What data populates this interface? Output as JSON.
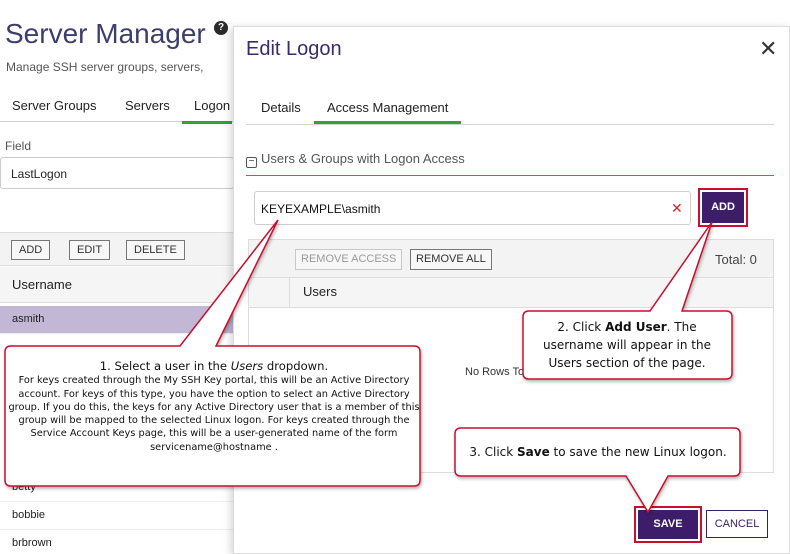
{
  "background": {
    "title": "Server Manager",
    "help_icon": "question-circle-icon",
    "subtitle": "Manage SSH server groups, servers,",
    "tabs": [
      "Server Groups",
      "Servers",
      "Logon"
    ],
    "field_label": "Field",
    "field_value": "LastLogon",
    "toolbar": [
      "ADD",
      "EDIT",
      "DELETE"
    ],
    "grid_header": "Username",
    "rows": [
      "asmith",
      "betty",
      "bobbie",
      "brbrown"
    ]
  },
  "dialog": {
    "title": "Edit Logon",
    "close_icon": "close-x-icon",
    "tabs": [
      "Details",
      "Access Management"
    ],
    "section_title": "Users & Groups with Logon Access",
    "user_value": "KEYEXAMPLE\\asmith",
    "add_label": "ADD",
    "remove_access_label": "REMOVE ACCESS",
    "remove_all_label": "REMOVE ALL",
    "total_label": "Total: 0",
    "users_header": "Users",
    "no_rows": "No Rows To",
    "save_label": "SAVE",
    "cancel_label": "CANCEL"
  },
  "callouts": {
    "step1_lead_a": "1. Select a  user in the ",
    "step1_lead_em": "Users",
    "step1_lead_b": " dropdown.",
    "step1_body": "For keys created through the My SSH Key portal, this will be an Active Directory account. For keys of this type, you have the option to select an Active Directory group. If you do this, the keys for any Active Directory user that is a member of this group will be mapped to the selected Linux logon. For keys created through the Service Account Keys page, this will be a user-generated name of the form servicename@hostname   .",
    "step2_a": "2. Click ",
    "step2_b": "Add User",
    "step2_c": ". The username will appear in the Users section of the page.",
    "step3_a": "3. Click ",
    "step3_b": "Save",
    "step3_c": " to save the new Linux logon."
  },
  "colors": {
    "accent_purple": "#3d1d6a",
    "tab_green": "#2fa52f",
    "callout_border": "#c8102e",
    "selected_row": "#c3b7d6"
  }
}
